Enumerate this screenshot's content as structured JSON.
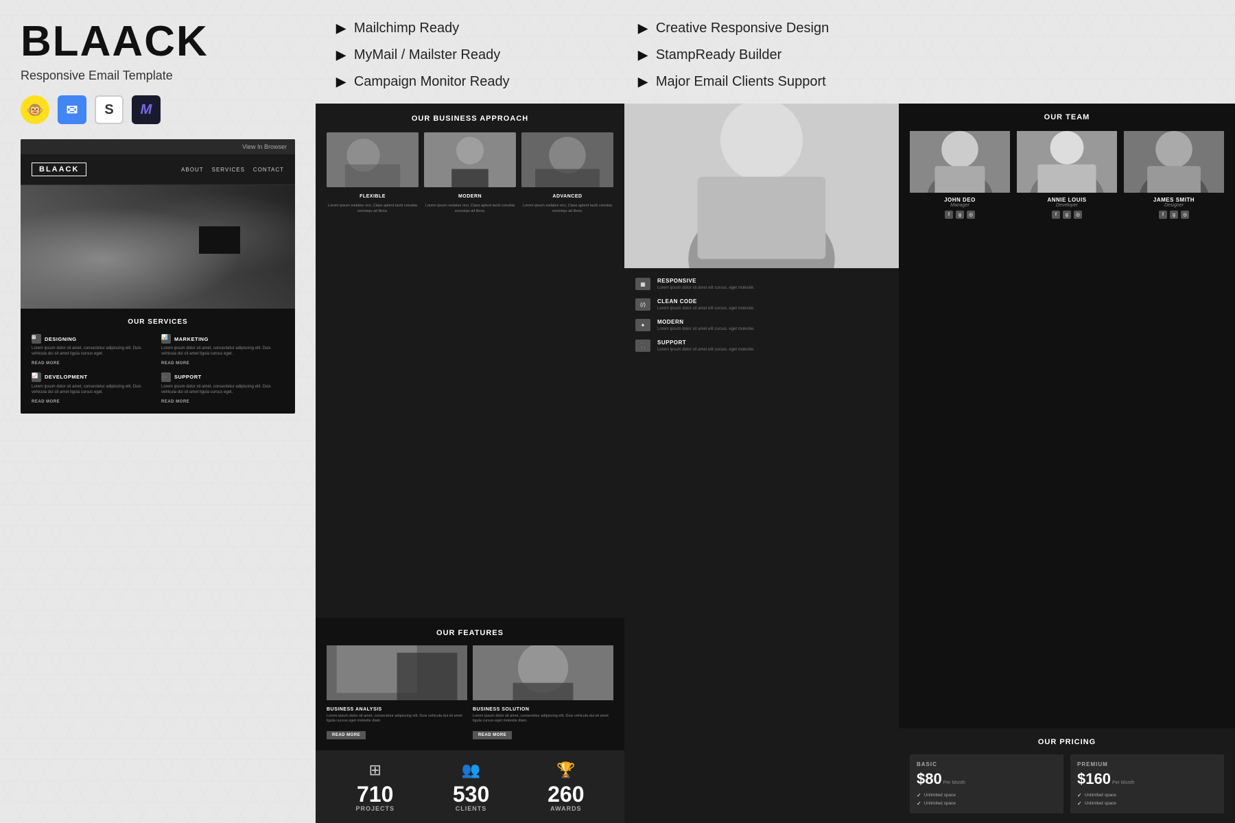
{
  "brand": {
    "title": "BLAACK",
    "subtitle": "Responsive Email Template",
    "tagline": "View In Browser"
  },
  "nav": {
    "items": [
      "ABOUT",
      "SERVICES",
      "CONTACT"
    ]
  },
  "features_list": [
    {
      "label": "Mailchimp Ready"
    },
    {
      "label": "MyMail / Mailster Ready"
    },
    {
      "label": "Campaign Monitor Ready"
    }
  ],
  "features_list_right": [
    {
      "label": "Creative Responsive Design"
    },
    {
      "label": "StampReady Builder"
    },
    {
      "label": "Major Email Clients Support"
    }
  ],
  "services": {
    "title": "OUR SERVICES",
    "items": [
      {
        "icon": "layers",
        "label": "DESIGNING",
        "text": "Lorem ipsum dolor sit amet, consectetur adipiscing elit. Duis vehicula dui sit amet ligula cursus eget.",
        "readmore": "READ MORE"
      },
      {
        "icon": "bar-chart",
        "label": "MARKETING",
        "text": "Lorem ipsum dolor sit amet, consectetur adipiscing elit. Duis vehicula dui sit amet ligula cursus eget.",
        "readmore": "READ MORE"
      },
      {
        "icon": "code",
        "label": "DEVELOPMENT",
        "text": "Lorem ipsum dolor sit amet, consectetur adipiscing elit. Duis vehicula dui sit amet ligula cursus eget.",
        "readmore": "READ MORE"
      },
      {
        "icon": "headset",
        "label": "SUPPORT",
        "text": "Lorem ipsum dolor sit amet, consectetur adipiscing elit. Duis vehicula dui sit amet ligula cursus eget.",
        "readmore": "READ MORE"
      }
    ]
  },
  "business": {
    "title": "OUR BUSINESS APPROACH",
    "items": [
      {
        "label": "FLEXIBLE",
        "text": "Lorem ipsum sodales orci. Class aptent taciti conubia sociosqu ad litora."
      },
      {
        "label": "MODERN",
        "text": "Lorem ipsum sodales orci. Class aptent taciti conubia sociosqu ad litora."
      },
      {
        "label": "ADVANCED",
        "text": "Lorem ipsum sodales orci. Class aptent taciti conubia sociosqu ad litora."
      }
    ]
  },
  "our_features": {
    "title": "OUR FEATURES",
    "items": [
      {
        "label": "BUSINESS ANALYSIS",
        "text": "Lorem ipsum dolor sit amet, consectetur adipiscing elit. Duis vehicula dui sit amet ligula cursus eget molestie diam.",
        "readmore": "READ MORE"
      },
      {
        "label": "BUSINESS SOLUTION",
        "text": "Lorem ipsum dolor sit amet, consectetur adipiscing elit. Duis vehicula dui sit amet ligula cursus eget molestie diam.",
        "readmore": "READ MORE"
      }
    ]
  },
  "stats": [
    {
      "number": "710",
      "label": "PROJECTS"
    },
    {
      "number": "530",
      "label": "CLIENTS"
    },
    {
      "number": "260",
      "label": "AWARDS"
    }
  ],
  "panel_features": [
    {
      "title": "RESPONSIVE",
      "desc": "Lorem ipsum dolor sit amet elit cursus. eget molestie."
    },
    {
      "title": "CLEAN CODE",
      "desc": "Lorem ipsum dolor sit amet elit cursus. eget molestie."
    },
    {
      "title": "MODERN",
      "desc": "Lorem ipsum dolor sit amet elit cursus. eget molestie."
    },
    {
      "title": "SUPPORT",
      "desc": "Lorem ipsum dolor sit amet elit cursus. eget molestie."
    }
  ],
  "team": {
    "title": "OUR TEAM",
    "members": [
      {
        "name": "JOHN DEO",
        "role": "Manager"
      },
      {
        "name": "ANNIE LOUIS",
        "role": "Developer"
      },
      {
        "name": "JAMES SMITH",
        "role": "Designer"
      }
    ]
  },
  "pricing": {
    "title": "OUR PRICING",
    "plans": [
      {
        "name": "BASIC",
        "price": "$80",
        "period": "Per Month",
        "features": [
          "Unlimited space",
          "Unlimited space"
        ]
      },
      {
        "name": "PREMIUM",
        "price": "$160",
        "period": "Per Month",
        "features": [
          "Unlimited space",
          "Unlimited space"
        ]
      }
    ]
  }
}
